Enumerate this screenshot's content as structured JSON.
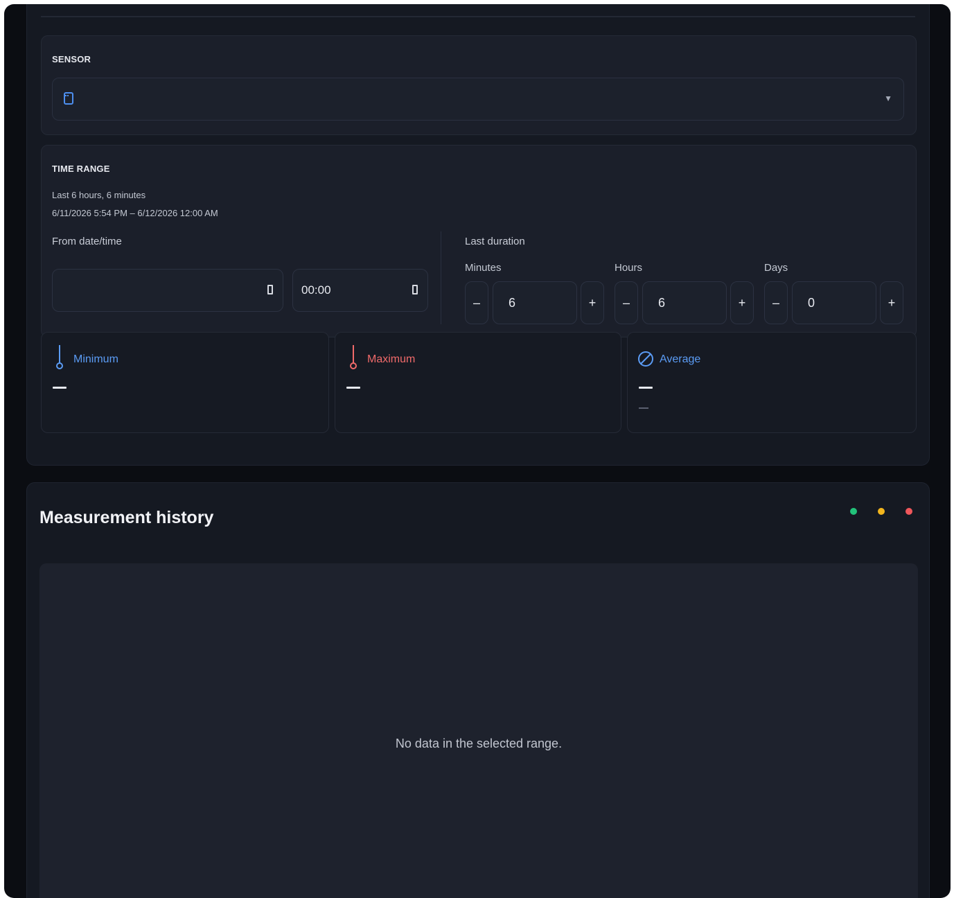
{
  "sensor": {
    "label": "SENSOR",
    "selected_value": "",
    "icon": "chip-icon"
  },
  "time_range": {
    "label": "TIME RANGE",
    "summary": "Last 6 hours, 6 minutes",
    "range_text": "6/11/2026 5:54 PM – 6/12/2026 12:00 AM",
    "from_label": "From date/time",
    "from_date_value": "",
    "from_time_value": "00:00",
    "last_duration_label": "Last duration",
    "minutes": {
      "label": "Minutes",
      "value": "6",
      "dec": "–",
      "inc": "+"
    },
    "hours": {
      "label": "Hours",
      "value": "6",
      "dec": "–",
      "inc": "+"
    },
    "days": {
      "label": "Days",
      "value": "0",
      "dec": "–",
      "inc": "+"
    }
  },
  "stats": {
    "minimum": {
      "label": "Minimum",
      "color": "#5b9cf5"
    },
    "maximum": {
      "label": "Maximum",
      "color": "#f06a6a"
    },
    "average": {
      "label": "Average",
      "color": "#5b9cf5"
    }
  },
  "history": {
    "title": "Measurement history",
    "empty_message": "No data in the selected range.",
    "dots": [
      "#22c27a",
      "#f2b51d",
      "#f0575b"
    ]
  }
}
